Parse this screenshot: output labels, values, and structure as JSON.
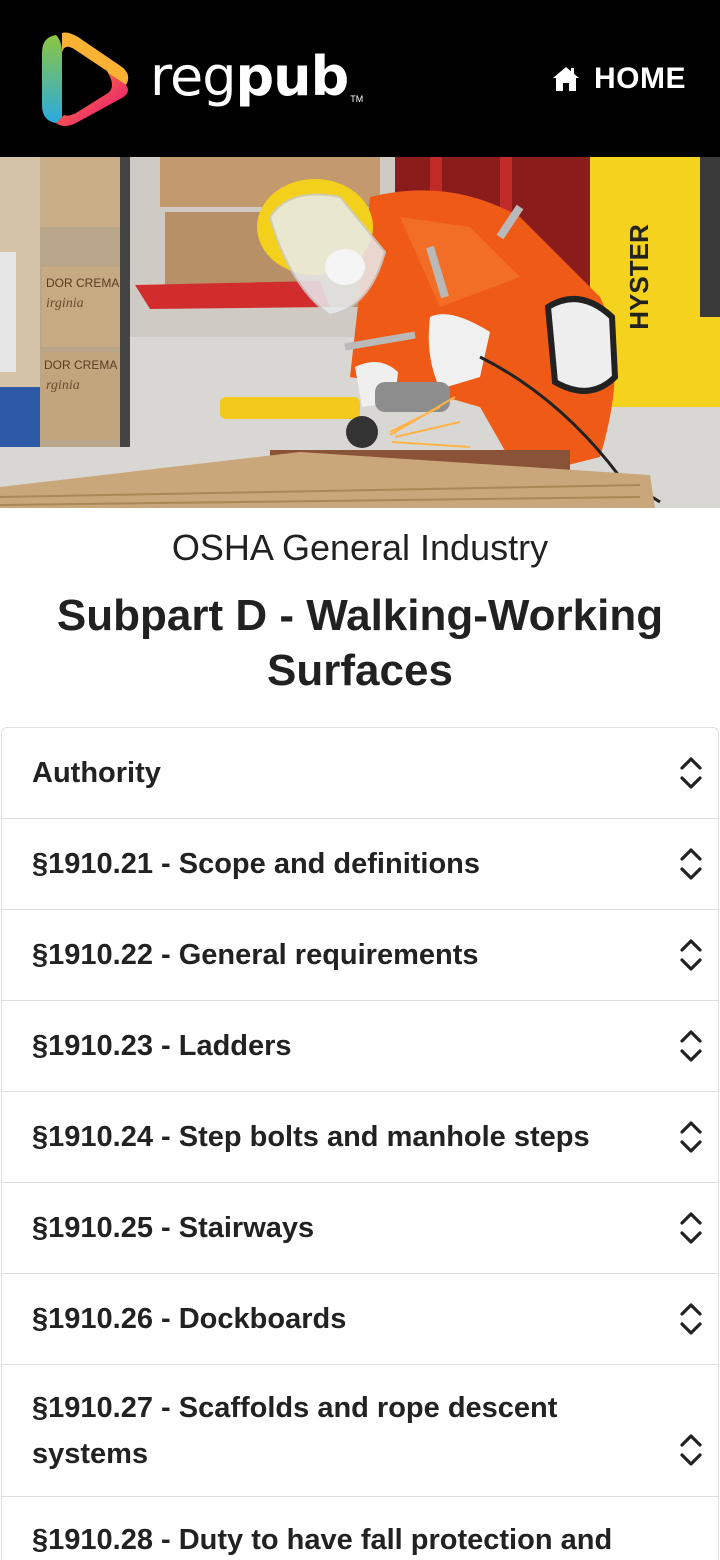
{
  "header": {
    "brand_light": "reg",
    "brand_bold": "pub",
    "brand_tm": "TM",
    "home_label": "HOME",
    "home_icon": "home-icon"
  },
  "hero": {
    "image": "worker-grinding-metal-photo",
    "box_text_1": "DOR CREMA",
    "box_text_2": "irginia",
    "box_text_3": "DOR CREMA",
    "box_text_4": "rginia",
    "forklift_text": "HYSTER"
  },
  "titles": {
    "subtitle": "OSHA General Industry",
    "title": "Subpart D - Walking-Working Surfaces"
  },
  "accordion": {
    "toggle_icon": "expand-collapse-chevron-icon",
    "items": [
      {
        "label": "Authority"
      },
      {
        "label": "§1910.21 - Scope and definitions"
      },
      {
        "label": "§1910.22 - General requirements"
      },
      {
        "label": "§1910.23 - Ladders"
      },
      {
        "label": "§1910.24 - Step bolts and manhole steps"
      },
      {
        "label": "§1910.25 - Stairways"
      },
      {
        "label": "§1910.26 - Dockboards"
      },
      {
        "label": "§1910.27 - Scaffolds and rope descent systems"
      },
      {
        "label": "§1910.28 - Duty to have fall protection and"
      }
    ]
  },
  "colors": {
    "header_bg": "#000000",
    "text": "#212121",
    "divider": "#dedede"
  }
}
